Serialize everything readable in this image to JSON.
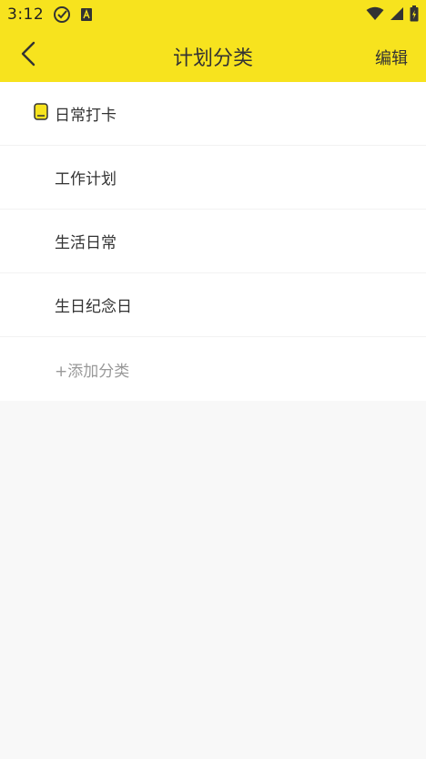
{
  "status_bar": {
    "time": "3:12",
    "icons": [
      "check-circle-icon",
      "accessibility-icon",
      "wifi-icon",
      "signal-icon",
      "battery-icon"
    ]
  },
  "header": {
    "title": "计划分类",
    "edit_label": "编辑",
    "background_color": "#f7e31e"
  },
  "categories": [
    {
      "label": "日常打卡",
      "selected": true
    },
    {
      "label": "工作计划",
      "selected": false
    },
    {
      "label": "生活日常",
      "selected": false
    },
    {
      "label": "生日纪念日",
      "selected": false
    }
  ],
  "add_category_label": "+添加分类"
}
